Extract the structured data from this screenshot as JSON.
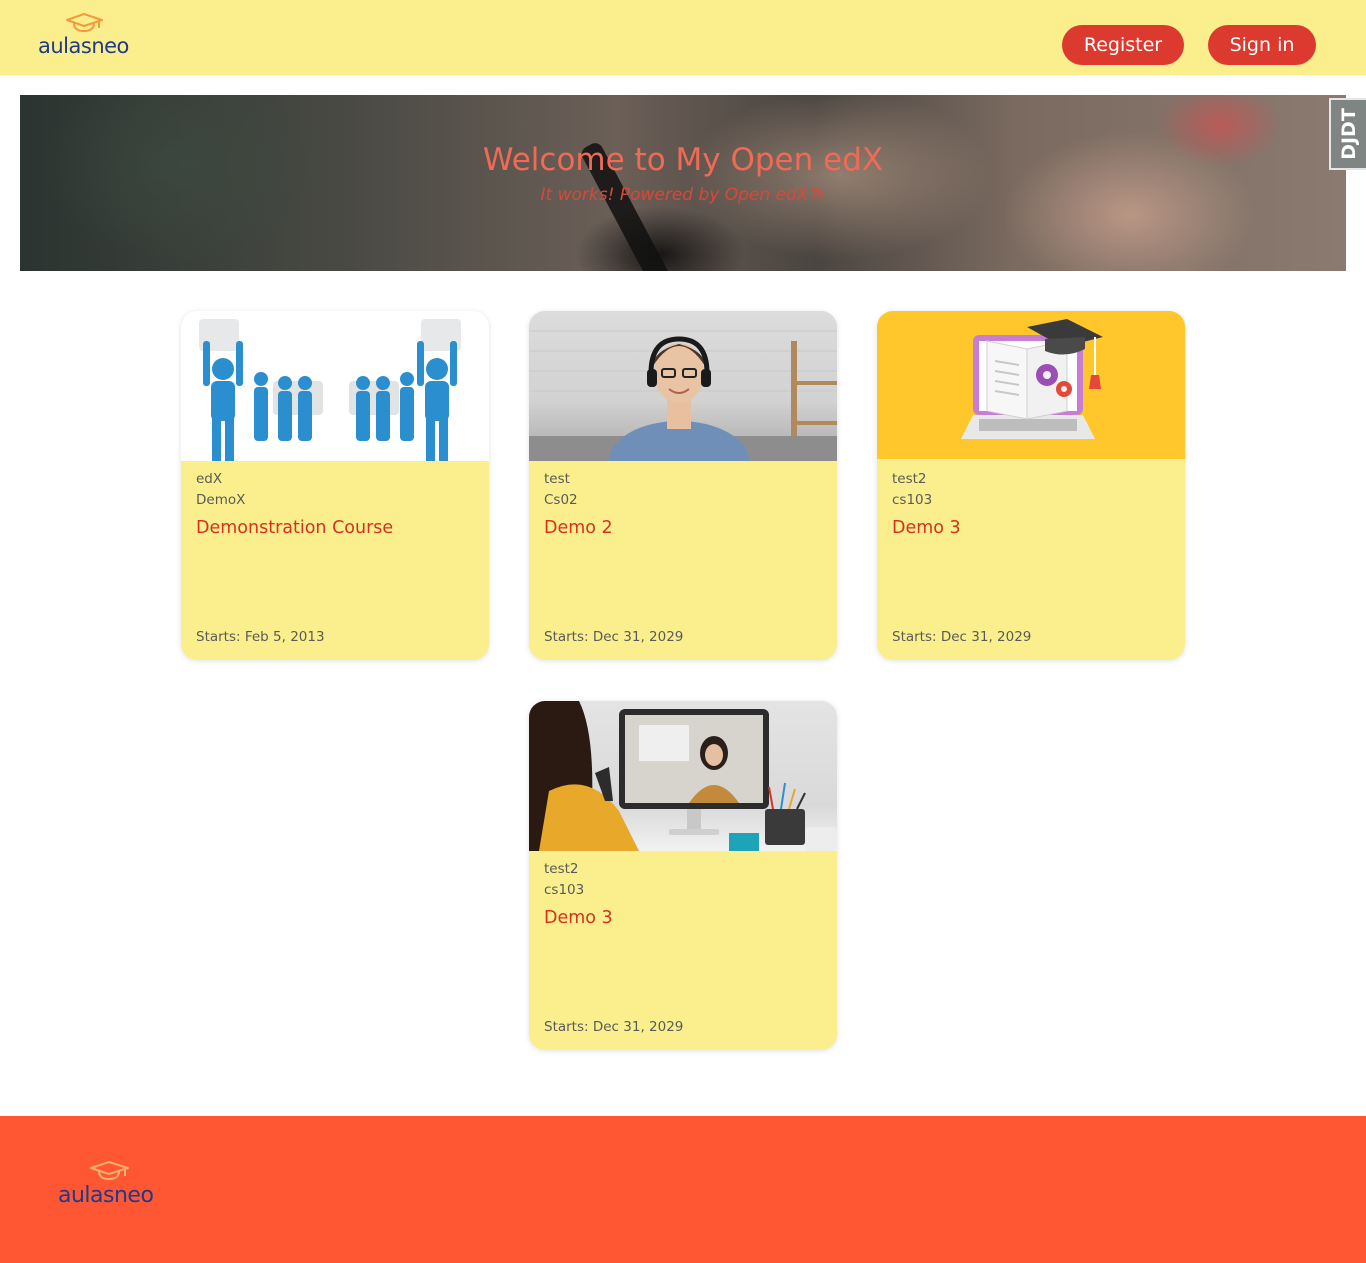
{
  "header": {
    "logo_text": "aulasneo",
    "register_label": "Register",
    "signin_label": "Sign in"
  },
  "hero": {
    "title": "Welcome to My Open edX",
    "subtitle": "It works! Powered by Open edX®"
  },
  "debug_toolbar": {
    "label": "DJDT"
  },
  "courses": [
    {
      "org": "edX",
      "number": "DemoX",
      "title": "Demonstration Course",
      "start": "Starts: Feb 5, 2013",
      "image": "puzzle-team-image"
    },
    {
      "org": "test",
      "number": "Cs02",
      "title": "Demo 2",
      "start": "Starts: Dec 31, 2029",
      "image": "student-headphones-image"
    },
    {
      "org": "test2",
      "number": "cs103",
      "title": "Demo 3",
      "start": "Starts: Dec 31, 2029",
      "image": "laptop-book-cap-image"
    },
    {
      "org": "test2",
      "number": "cs103",
      "title": "Demo 3",
      "start": "Starts: Dec 31, 2029",
      "image": "video-call-image"
    }
  ],
  "footer": {
    "logo_text": "aulasneo"
  },
  "colors": {
    "header_bg": "#fbef8d",
    "button_bg": "#dc3a2f",
    "card_bg": "#fbef8d",
    "card_title": "#d43322",
    "footer_bg": "#ff5733",
    "logo_text": "#1f3a8a",
    "logo_cap": "#f49a3a"
  }
}
